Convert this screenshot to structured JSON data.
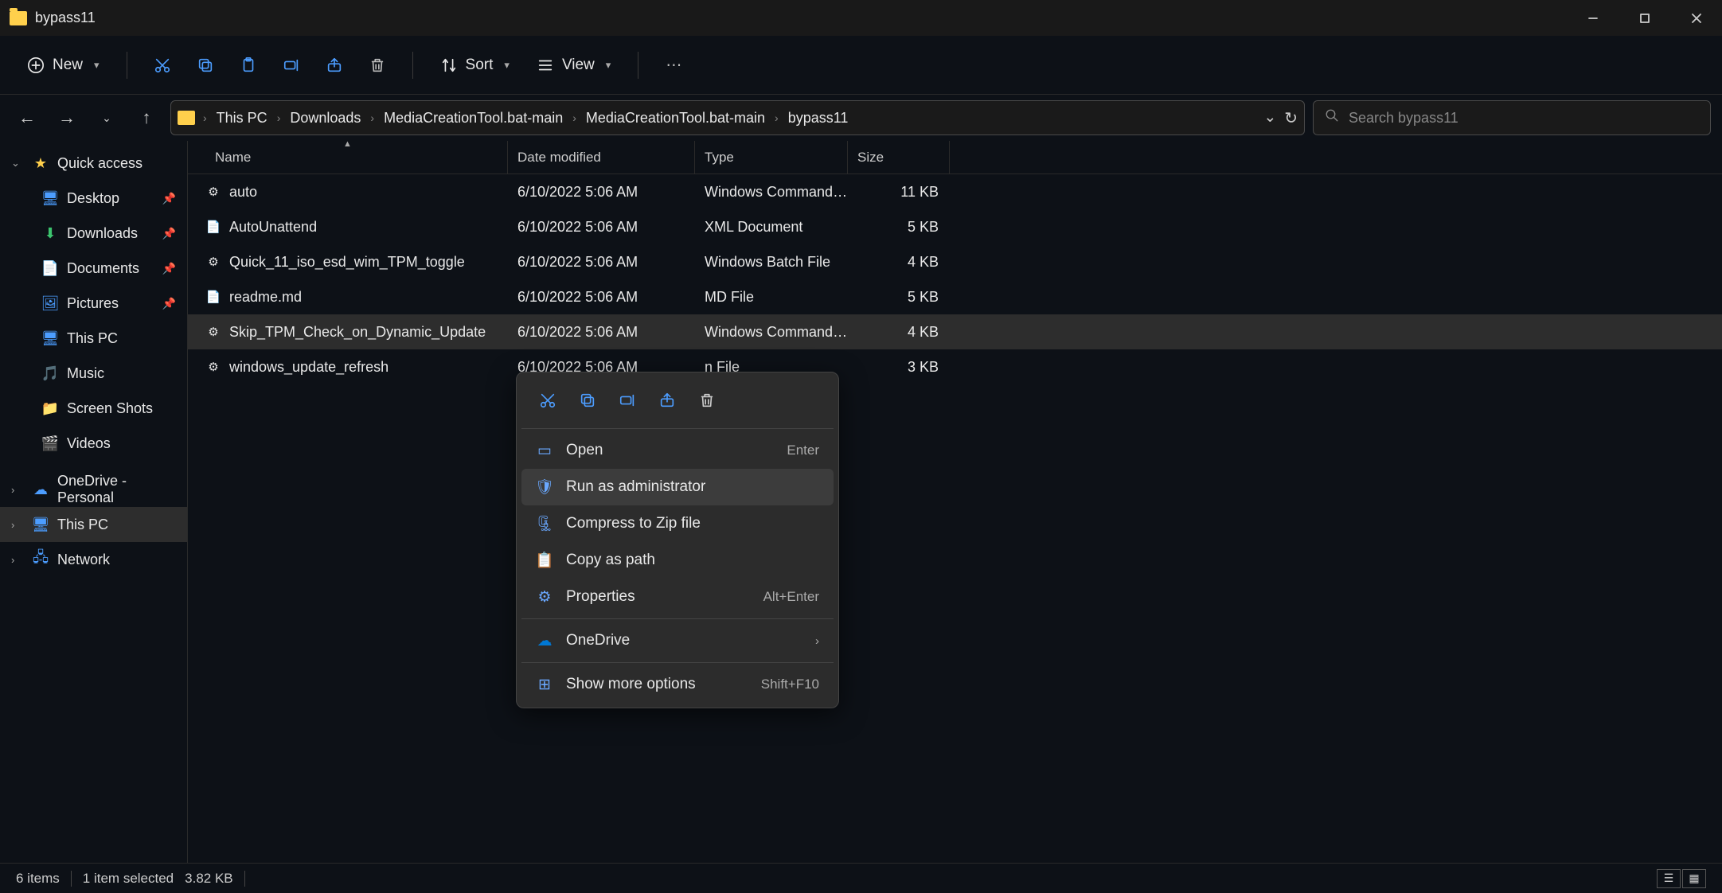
{
  "window": {
    "title": "bypass11"
  },
  "toolbar": {
    "new_label": "New",
    "sort_label": "Sort",
    "view_label": "View"
  },
  "breadcrumbs": [
    "This PC",
    "Downloads",
    "MediaCreationTool.bat-main",
    "MediaCreationTool.bat-main",
    "bypass11"
  ],
  "search": {
    "placeholder": "Search bypass11"
  },
  "sidebar": {
    "quick_access": "Quick access",
    "items": [
      {
        "label": "Desktop",
        "pinned": true
      },
      {
        "label": "Downloads",
        "pinned": true
      },
      {
        "label": "Documents",
        "pinned": true
      },
      {
        "label": "Pictures",
        "pinned": true
      },
      {
        "label": "This PC",
        "pinned": false
      },
      {
        "label": "Music",
        "pinned": false
      },
      {
        "label": "Screen Shots",
        "pinned": false
      },
      {
        "label": "Videos",
        "pinned": false
      }
    ],
    "onedrive": "OneDrive - Personal",
    "thispc": "This PC",
    "network": "Network"
  },
  "columns": {
    "name": "Name",
    "date": "Date modified",
    "type": "Type",
    "size": "Size"
  },
  "files": [
    {
      "name": "auto",
      "date": "6/10/2022 5:06 AM",
      "type": "Windows Command ...",
      "size": "11 KB"
    },
    {
      "name": "AutoUnattend",
      "date": "6/10/2022 5:06 AM",
      "type": "XML Document",
      "size": "5 KB"
    },
    {
      "name": "Quick_11_iso_esd_wim_TPM_toggle",
      "date": "6/10/2022 5:06 AM",
      "type": "Windows Batch File",
      "size": "4 KB"
    },
    {
      "name": "readme.md",
      "date": "6/10/2022 5:06 AM",
      "type": "MD File",
      "size": "5 KB"
    },
    {
      "name": "Skip_TPM_Check_on_Dynamic_Update",
      "date": "6/10/2022 5:06 AM",
      "type": "Windows Command ...",
      "size": "4 KB"
    },
    {
      "name": "windows_update_refresh",
      "date": "6/10/2022 5:06 AM",
      "type": "n File",
      "size": "3 KB"
    }
  ],
  "context_menu": {
    "open": {
      "label": "Open",
      "accel": "Enter"
    },
    "run_admin": {
      "label": "Run as administrator"
    },
    "compress": {
      "label": "Compress to Zip file"
    },
    "copy_path": {
      "label": "Copy as path"
    },
    "properties": {
      "label": "Properties",
      "accel": "Alt+Enter"
    },
    "onedrive": {
      "label": "OneDrive"
    },
    "more": {
      "label": "Show more options",
      "accel": "Shift+F10"
    }
  },
  "status": {
    "count": "6 items",
    "selected": "1 item selected",
    "size": "3.82 KB"
  }
}
